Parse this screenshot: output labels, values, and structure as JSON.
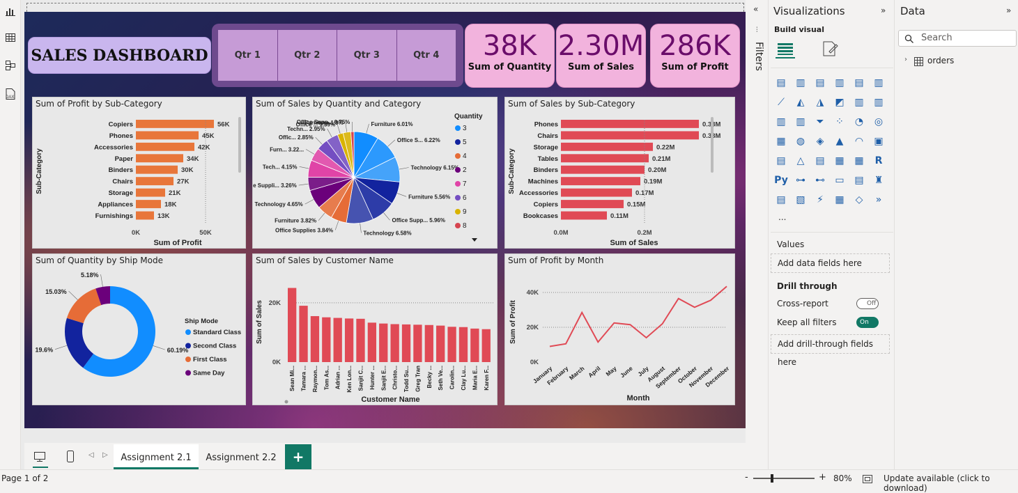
{
  "dashboard": {
    "title": "SALES DASHBOARD",
    "quarters": [
      "Qtr 1",
      "Qtr 2",
      "Qtr 3",
      "Qtr 4"
    ],
    "kpis": [
      {
        "value": "38K",
        "label": "Sum of Quantity"
      },
      {
        "value": "2.30M",
        "label": "Sum of Sales"
      },
      {
        "value": "286K",
        "label": "Sum of Profit"
      }
    ]
  },
  "visualizations_pane": {
    "title": "Visualizations",
    "build_visual": "Build visual",
    "more": "...",
    "values_label": "Values",
    "values_placeholder": "Add data fields here",
    "drill_through": "Drill through",
    "cross_report": "Cross-report",
    "cross_report_state": "Off",
    "keep_all_filters": "Keep all filters",
    "keep_all_filters_state": "On",
    "drill_placeholder": "Add drill-through fields here",
    "icons": [
      "stacked-bar-icon",
      "stacked-column-icon",
      "clustered-bar-icon",
      "clustered-column-icon",
      "100-bar-icon",
      "100-column-icon",
      "line-chart-icon",
      "area-chart-icon",
      "stacked-area-icon",
      "ribbon-icon",
      "waterfall-icon",
      "line-column-icon",
      "line-stacked-column-icon",
      "ribbon-chart-icon",
      "funnel-icon",
      "scatter-icon",
      "pie-icon",
      "donut-icon",
      "treemap-icon",
      "map-icon",
      "filled-map-icon",
      "azure-map-icon",
      "gauge-icon",
      "card-icon",
      "multi-row-card-icon",
      "kpi-icon",
      "slicer-icon",
      "table-icon",
      "matrix-icon",
      "r-visual-icon",
      "python-icon",
      "key-influencers-icon",
      "decomposition-tree-icon",
      "qa-icon",
      "smart-narrative-icon",
      "goals-icon",
      "paginated-icon",
      "power-apps-icon",
      "power-automate-icon",
      "arcgis-icon",
      "diamond-icon",
      "chevrons-icon"
    ]
  },
  "filters_rail": {
    "label": "Filters"
  },
  "data_pane": {
    "title": "Data",
    "search_placeholder": "Search",
    "tables": [
      "orders"
    ]
  },
  "tabs": {
    "items": [
      "Assignment 2.1",
      "Assignment 2.2"
    ],
    "active": 0,
    "add": "+"
  },
  "status": {
    "page": "Page 1 of 2",
    "zoom": "80%",
    "update": "Update available (click to download)",
    "zoom_minus": "-",
    "zoom_plus": "+"
  },
  "chart_data": [
    {
      "type": "bar",
      "orientation": "horizontal",
      "title": "Sum of Profit by Sub-Category",
      "xlabel": "Sum of Profit",
      "ylabel": "Sub-Category",
      "categories": [
        "Copiers",
        "Phones",
        "Accessories",
        "Paper",
        "Binders",
        "Chairs",
        "Storage",
        "Appliances",
        "Furnishings"
      ],
      "values": [
        56000,
        45000,
        42000,
        34000,
        30000,
        27000,
        21000,
        18000,
        13000
      ],
      "labels": [
        "56K",
        "45K",
        "42K",
        "34K",
        "30K",
        "27K",
        "21K",
        "18K",
        "13K"
      ],
      "xticks": [
        "0K",
        "50K"
      ],
      "xlim": [
        0,
        60000
      ],
      "color": "#e8763a"
    },
    {
      "type": "pie",
      "title": "Sum of Sales by Quantity and Category",
      "legend_title": "Quantity",
      "legend": [
        {
          "name": "3",
          "color": "#118dff"
        },
        {
          "name": "5",
          "color": "#12239e"
        },
        {
          "name": "4",
          "color": "#e66c37"
        },
        {
          "name": "2",
          "color": "#6b007b"
        },
        {
          "name": "7",
          "color": "#e044a7"
        },
        {
          "name": "6",
          "color": "#744ec2"
        },
        {
          "name": "9",
          "color": "#d9b300"
        },
        {
          "name": "8",
          "color": "#d64550"
        }
      ],
      "slices": [
        {
          "label": "Furniture 6.01%",
          "value": 6.01,
          "color": "#118dff"
        },
        {
          "label": "Office S... 6.22%",
          "value": 6.22,
          "color": "#118dff"
        },
        {
          "label": "Technology 6.15%",
          "value": 6.15,
          "color": "#118dff"
        },
        {
          "label": "Furniture 5.56%",
          "value": 5.56,
          "color": "#12239e"
        },
        {
          "label": "Office Supp... 5.96%",
          "value": 5.96,
          "color": "#12239e"
        },
        {
          "label": "Technology 6.58%",
          "value": 6.58,
          "color": "#12239e"
        },
        {
          "label": "Office Supplies 3.84%",
          "value": 3.84,
          "color": "#e66c37"
        },
        {
          "label": "Furniture 3.82%",
          "value": 3.82,
          "color": "#e66c37"
        },
        {
          "label": "Technology 4.65%",
          "value": 4.65,
          "color": "#6b007b"
        },
        {
          "label": "Office Suppli... 3.26%",
          "value": 3.26,
          "color": "#6b007b"
        },
        {
          "label": "Tech... 4.15%",
          "value": 4.15,
          "color": "#e044a7"
        },
        {
          "label": "Furn... 3.22...",
          "value": 3.22,
          "color": "#e044a7"
        },
        {
          "label": "Offic... 2.85%",
          "value": 2.85,
          "color": "#744ec2"
        },
        {
          "label": "Techn... 2.95%",
          "value": 2.95,
          "color": "#744ec2"
        },
        {
          "label": "Office ... 1.39%",
          "value": 1.39,
          "color": "#d9b300"
        },
        {
          "label": "Furniture 1.9%",
          "value": 1.9,
          "color": "#d9b300"
        },
        {
          "label": "Office Supp... 0.75%",
          "value": 0.75,
          "color": "#d64550"
        }
      ]
    },
    {
      "type": "bar",
      "orientation": "horizontal",
      "title": "Sum of Sales by Sub-Category",
      "xlabel": "Sum of Sales",
      "ylabel": "Sub-Category",
      "categories": [
        "Phones",
        "Chairs",
        "Storage",
        "Tables",
        "Binders",
        "Machines",
        "Accessories",
        "Copiers",
        "Bookcases"
      ],
      "values": [
        0.33,
        0.33,
        0.22,
        0.21,
        0.2,
        0.19,
        0.17,
        0.15,
        0.11
      ],
      "labels": [
        "0.33M",
        "0.33M",
        "0.22M",
        "0.21M",
        "0.20M",
        "0.19M",
        "0.17M",
        "0.15M",
        "0.11M"
      ],
      "xticks": [
        "0.0M",
        "0.2M"
      ],
      "xlim": [
        0,
        0.35
      ],
      "color": "#e04a55"
    },
    {
      "type": "donut",
      "title": "Sum of Quantity by Ship Mode",
      "legend_title": "Ship Mode",
      "slices": [
        {
          "name": "Standard Class",
          "value": 60.19,
          "label": "60.19%",
          "color": "#118dff"
        },
        {
          "name": "Second Class",
          "value": 19.6,
          "label": "19.6%",
          "color": "#12239e"
        },
        {
          "name": "First Class",
          "value": 15.03,
          "label": "15.03%",
          "color": "#e66c37"
        },
        {
          "name": "Same Day",
          "value": 5.18,
          "label": "5.18%",
          "color": "#6b007b"
        }
      ]
    },
    {
      "type": "bar",
      "title": "Sum of Sales by Customer Name",
      "xlabel": "Customer Name",
      "ylabel": "Sum of Sales",
      "categories": [
        "Sean Mi...",
        "Tamara ...",
        "Raymon...",
        "Tom As...",
        "Adrian ...",
        "Ken Lon...",
        "Sanjit C...",
        "Hunter ...",
        "Sanjit E...",
        "Christo...",
        "Todd Su...",
        "Greg Tran",
        "Becky ...",
        "Seth Ve...",
        "Carolin...",
        "Clay Lu...",
        "Maria E...",
        "Karen F..."
      ],
      "values": [
        25000,
        19000,
        15500,
        15100,
        14900,
        14700,
        14600,
        13300,
        13000,
        12800,
        12700,
        12600,
        12500,
        12300,
        11900,
        11800,
        11300,
        11100
      ],
      "yticks": [
        "0K",
        "20K"
      ],
      "ylim": [
        0,
        27000
      ],
      "color": "#e04a55"
    },
    {
      "type": "line",
      "title": "Sum of Profit by Month",
      "xlabel": "Month",
      "ylabel": "Sum of Profit",
      "x": [
        "January",
        "February",
        "March",
        "April",
        "May",
        "June",
        "July",
        "August",
        "September",
        "October",
        "November",
        "December"
      ],
      "y": [
        9000,
        10500,
        28500,
        11500,
        22500,
        21500,
        14000,
        22000,
        36500,
        31500,
        35500,
        43500
      ],
      "yticks": [
        "0K",
        "20K",
        "40K"
      ],
      "ylim": [
        0,
        46000
      ],
      "color": "#e04a55"
    }
  ]
}
